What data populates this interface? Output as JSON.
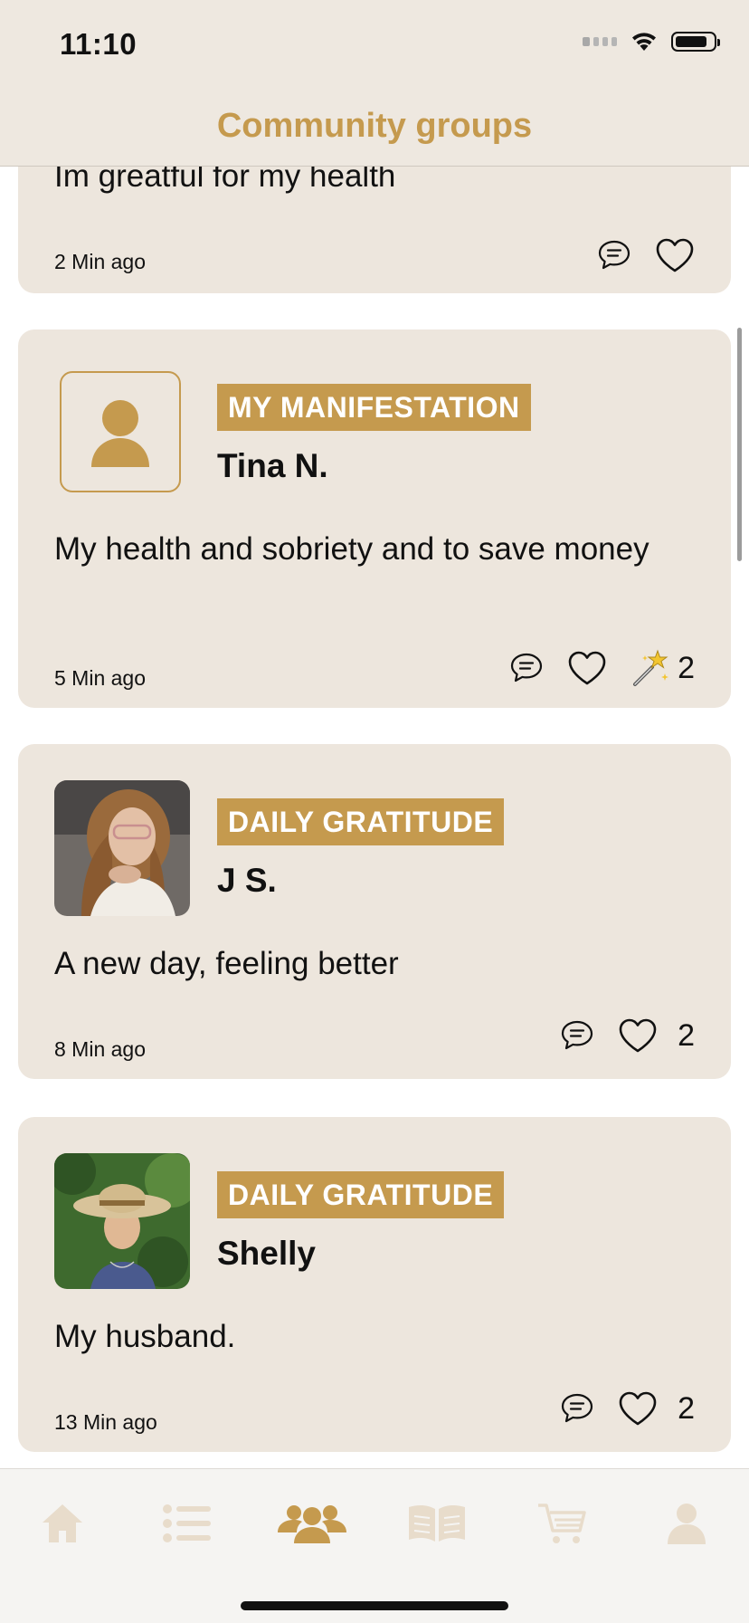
{
  "status_bar": {
    "time": "11:10"
  },
  "header": {
    "title": "Community groups"
  },
  "colors": {
    "accent": "#C59A4E",
    "card_bg": "#EDE6DD",
    "header_bg": "#EEE8E0",
    "tab_inactive": "#E8DCCB"
  },
  "posts": [
    {
      "text": "Im greatful for my health",
      "time": "2 Min ago"
    },
    {
      "tag": "MY MANIFESTATION",
      "name": "Tina N.",
      "text": "My health and sobriety and to save money",
      "time": "5 Min ago",
      "manifest_count": "2"
    },
    {
      "tag": "DAILY GRATITUDE",
      "name": "J S.",
      "text": "A new day, feeling better",
      "time": "8 Min ago",
      "like_count": "2"
    },
    {
      "tag": "DAILY GRATITUDE",
      "name": "Shelly",
      "text": "My husband.",
      "time": "13 Min ago",
      "like_count": "2"
    }
  ],
  "tabs": [
    {
      "icon": "home-icon",
      "active": false
    },
    {
      "icon": "list-icon",
      "active": false
    },
    {
      "icon": "community-icon",
      "active": true
    },
    {
      "icon": "book-icon",
      "active": false
    },
    {
      "icon": "cart-icon",
      "active": false
    },
    {
      "icon": "profile-icon",
      "active": false
    }
  ]
}
